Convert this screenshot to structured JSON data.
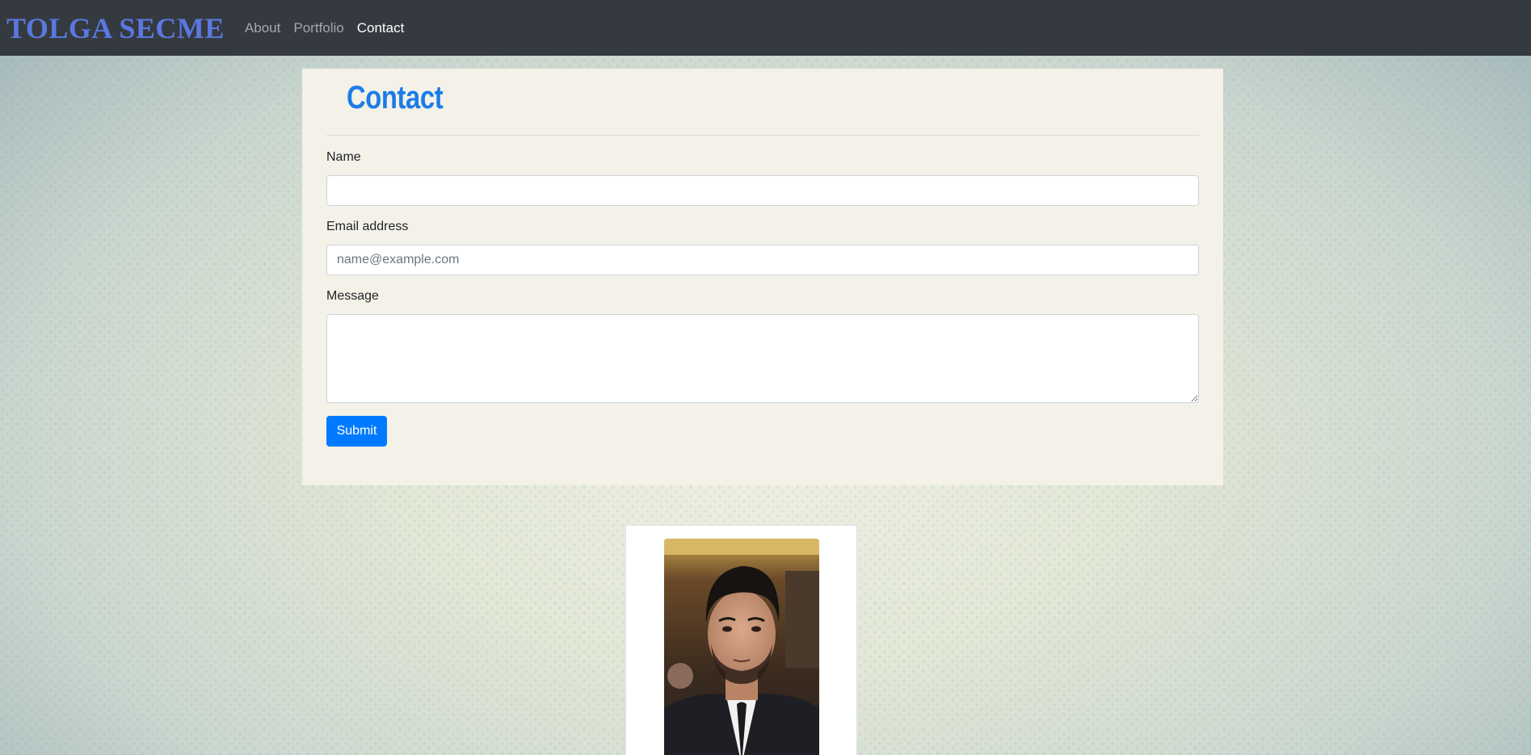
{
  "navbar": {
    "brand": "TOLGA SECME",
    "links": [
      "About",
      "Portfolio",
      "Contact"
    ],
    "active": "Contact"
  },
  "contact": {
    "title": "Contact",
    "name_label": "Name",
    "name_value": "",
    "email_label": "Email address",
    "email_placeholder": "name@example.com",
    "message_label": "Message",
    "message_value": "",
    "submit_label": "Submit"
  },
  "colors": {
    "navbar_bg": "#343a40",
    "brand": "#5b78e0",
    "title": "#1b7ce8",
    "button": "#007bff",
    "card_bg": "#f3f1e8"
  }
}
